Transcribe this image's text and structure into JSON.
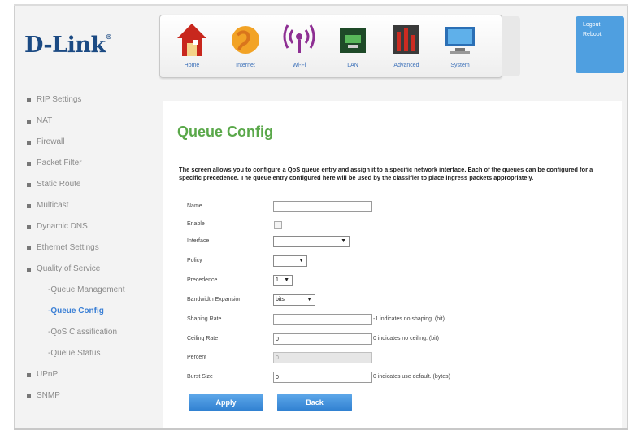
{
  "brand": {
    "logo": "D-Link",
    "tm": "®"
  },
  "nav": [
    {
      "label": "Home",
      "icon": "home-icon"
    },
    {
      "label": "Internet",
      "icon": "internet-icon"
    },
    {
      "label": "Wi-Fi",
      "icon": "wifi-icon"
    },
    {
      "label": "LAN",
      "icon": "lan-icon"
    },
    {
      "label": "Advanced",
      "icon": "advanced-icon"
    },
    {
      "label": "System",
      "icon": "system-icon"
    }
  ],
  "user": {
    "logout": "Logout",
    "reboot": "Reboot"
  },
  "sidebar": {
    "items": [
      {
        "label": "RIP Settings"
      },
      {
        "label": "NAT"
      },
      {
        "label": "Firewall"
      },
      {
        "label": "Packet Filter"
      },
      {
        "label": "Static Route"
      },
      {
        "label": "Multicast"
      },
      {
        "label": "Dynamic DNS"
      },
      {
        "label": "Ethernet Settings"
      },
      {
        "label": "Quality of Service"
      }
    ],
    "subitems": [
      {
        "label": "-Queue Management"
      },
      {
        "label": "-Queue Config"
      },
      {
        "label": "-QoS Classification"
      },
      {
        "label": "-Queue Status"
      }
    ],
    "after": [
      {
        "label": "UPnP"
      },
      {
        "label": "SNMP"
      }
    ]
  },
  "main": {
    "title": "Queue Config",
    "description": "The screen allows you to configure a QoS queue entry and assign it to a specific network interface. Each of the queues can be configured for a specific precedence. The queue entry configured here will be used by the classifier to place ingress packets appropriately."
  },
  "form": {
    "name_label": "Name",
    "name_value": "",
    "enable_label": "Enable",
    "interface_label": "Interface",
    "interface_value": "",
    "policy_label": "Policy",
    "policy_value": "",
    "precedence_label": "Precedence",
    "precedence_value": "1",
    "bandwidth_label": "Bandwidth Expansion",
    "bandwidth_value": "bits",
    "shaping_label": "Shaping Rate",
    "shaping_value": "",
    "shaping_hint": "-1 indicates no shaping. (bit)",
    "ceiling_label": "Ceiling Rate",
    "ceiling_value": "0",
    "ceiling_hint": "0 indicates no ceiling. (bit)",
    "percent_label": "Percent",
    "percent_value": "0",
    "burst_label": "Burst Size",
    "burst_value": "0",
    "burst_hint": "0 indicates use default. (bytes)"
  },
  "buttons": {
    "apply": "Apply",
    "back": "Back"
  },
  "colors": {
    "accent": "#3a7fd5",
    "title": "#5aa84a",
    "logo": "#1b4a83"
  }
}
